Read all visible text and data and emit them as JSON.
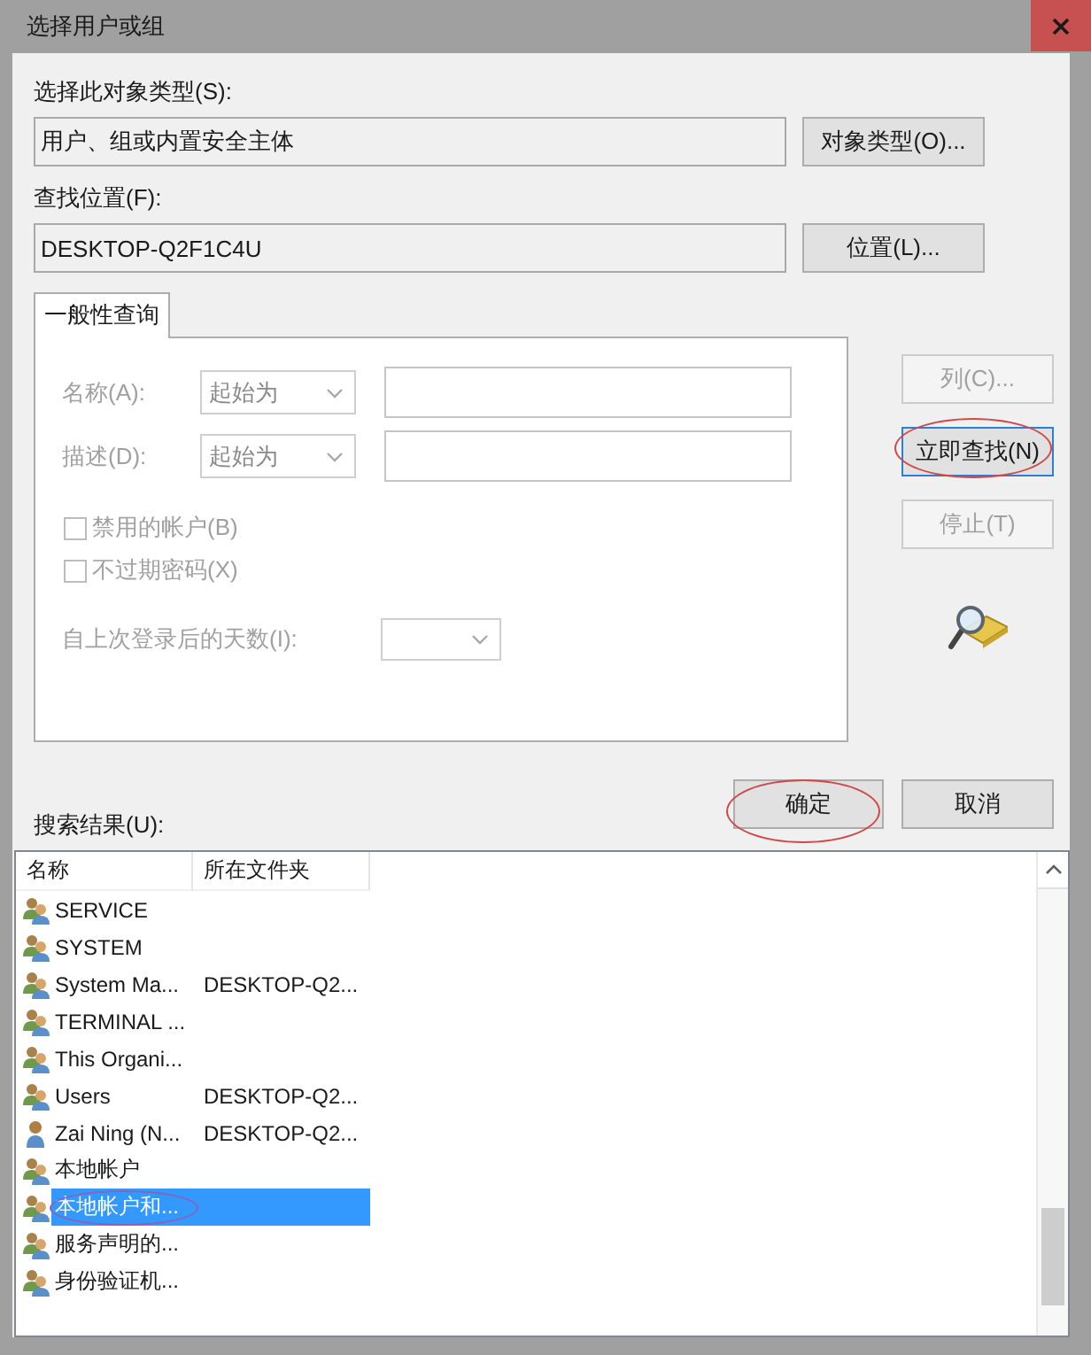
{
  "window": {
    "title": "选择用户或组"
  },
  "object_type": {
    "label": "选择此对象类型(S):",
    "value": "用户、组或内置安全主体",
    "button": {
      "label": "对象类型(O)..."
    }
  },
  "location": {
    "label": "查找位置(F):",
    "value": "DESKTOP-Q2F1C4U",
    "button": {
      "label": "位置(L)..."
    }
  },
  "tabs": [
    {
      "label": "一般性查询",
      "selected": true
    }
  ],
  "query": {
    "fields": [
      {
        "label": "名称(A):",
        "operator": "起始为",
        "disabled": true
      },
      {
        "label": "描述(D):",
        "operator": "起始为",
        "disabled": true
      }
    ],
    "checkboxes": [
      {
        "label": "禁用的帐户(B)",
        "checked": false,
        "disabled": true
      },
      {
        "label": "不过期密码(X)",
        "checked": false,
        "disabled": true
      }
    ],
    "days": {
      "label": "自上次登录后的天数(I):",
      "disabled": true
    }
  },
  "side_buttons": [
    {
      "label": "列(C)...",
      "disabled": true,
      "default": false,
      "highlighted": false
    },
    {
      "label": "立即查找(N)",
      "disabled": false,
      "default": true,
      "highlighted": true
    },
    {
      "label": "停止(T)",
      "disabled": true,
      "default": false,
      "highlighted": false
    }
  ],
  "dialog_buttons": [
    {
      "label": "确定",
      "highlighted": true
    },
    {
      "label": "取消",
      "highlighted": false
    }
  ],
  "results": {
    "label": "搜索结果(U):",
    "columns": [
      "名称",
      "所在文件夹"
    ],
    "rows": [
      {
        "kind": "group",
        "name": "SERVICE",
        "selected": false,
        "highlighted": false
      },
      {
        "kind": "group",
        "name": "SYSTEM",
        "selected": false,
        "highlighted": false
      },
      {
        "kind": "group",
        "name": "System Ma...",
        "folder": "DESKTOP-Q2...",
        "selected": false,
        "highlighted": false
      },
      {
        "kind": "group",
        "name": "TERMINAL ...",
        "selected": false,
        "highlighted": false
      },
      {
        "kind": "group",
        "name": "This Organi...",
        "selected": false,
        "highlighted": false
      },
      {
        "kind": "group",
        "name": "Users",
        "folder": "DESKTOP-Q2...",
        "selected": false,
        "highlighted": false
      },
      {
        "kind": "user",
        "name": "Zai Ning (N...",
        "folder": "DESKTOP-Q2...",
        "selected": false,
        "highlighted": false
      },
      {
        "kind": "group",
        "name": "本地帐户",
        "selected": false,
        "highlighted": false
      },
      {
        "kind": "group",
        "name": "本地帐户和...",
        "selected": true,
        "highlighted": true
      },
      {
        "kind": "group",
        "name": "服务声明的...",
        "selected": false,
        "highlighted": false
      },
      {
        "kind": "group",
        "name": "身份验证机...",
        "selected": false,
        "highlighted": false
      }
    ]
  }
}
